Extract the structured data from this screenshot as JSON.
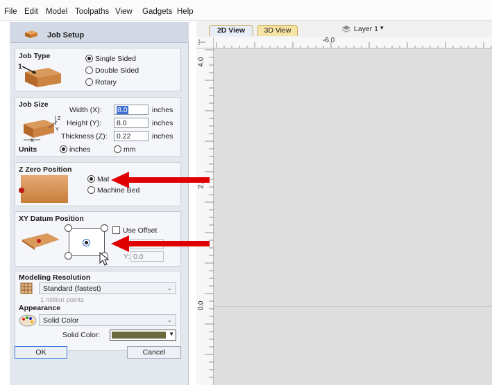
{
  "menubar": {
    "items": [
      "File",
      "Edit",
      "Model",
      "Toolpaths",
      "View",
      "Gadgets",
      "Help"
    ]
  },
  "panel": {
    "title": "Job Setup",
    "job_type": {
      "heading": "Job Type",
      "options": [
        "Single Sided",
        "Double Sided",
        "Rotary"
      ],
      "selected": "Single Sided",
      "diagram_label": "1"
    },
    "job_size": {
      "heading": "Job Size",
      "width_label": "Width (X):",
      "width_value": "8.0",
      "height_label": "Height (Y):",
      "height_value": "8.0",
      "thickness_label": "Thickness (Z):",
      "thickness_value": "0.22",
      "unit_text": "inches",
      "units_label": "Units",
      "units_options": [
        "inches",
        "mm"
      ],
      "units_selected": "inches",
      "diagram_axes": [
        "Z",
        "X",
        "Y"
      ]
    },
    "z_zero": {
      "heading": "Z Zero Position",
      "options": [
        "Mat",
        "Machine Bed"
      ],
      "selected": "Mat"
    },
    "xy_datum": {
      "heading": "XY Datum Position",
      "use_offset_label": "Use Offset",
      "x_value": "0.0",
      "y_label": "Y:",
      "y_value": "0.0"
    },
    "modeling": {
      "heading": "Modeling Resolution",
      "value": "Standard (fastest)",
      "sub": "1 million points"
    },
    "appearance": {
      "heading": "Appearance",
      "value": "Solid Color",
      "solid_color_label": "Solid Color:",
      "swatch_color": "#6b6a3d"
    },
    "buttons": {
      "ok": "OK",
      "cancel": "Cancel"
    }
  },
  "view_tabs": {
    "tabs": [
      "2D View",
      "3D View"
    ],
    "active": "2D View",
    "layer_label": "Layer 1",
    "tab_2d_color": "#e7eef9",
    "tab_3d_color": "#f6e4a5"
  },
  "rulers": {
    "h_label": "-6.0",
    "v_labels": [
      "4.0",
      "2.0",
      "0.0"
    ]
  },
  "annotations": {
    "arrow_color": "#e00000"
  }
}
